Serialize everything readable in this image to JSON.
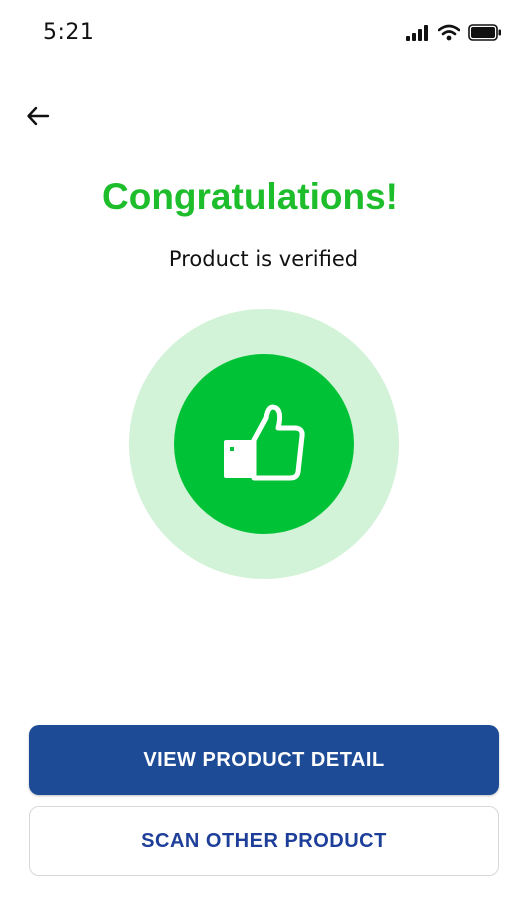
{
  "status_bar": {
    "time": "5:21",
    "icons": [
      "signal-icon",
      "wifi-icon",
      "battery-icon"
    ]
  },
  "navigation": {
    "back_icon": "arrow-left-icon"
  },
  "result": {
    "title": "Congratulations!",
    "subtitle": "Product is verified",
    "icon": "thumbs-up-icon"
  },
  "actions": {
    "primary_label": "VIEW PRODUCT DETAIL",
    "secondary_label": "SCAN OTHER PRODUCT"
  },
  "colors": {
    "success_green": "#1dbd2b",
    "badge_green": "#00c236",
    "badge_halo": "#d2f3d8",
    "primary_blue": "#1e4b96",
    "secondary_text_blue": "#1e3f99"
  }
}
